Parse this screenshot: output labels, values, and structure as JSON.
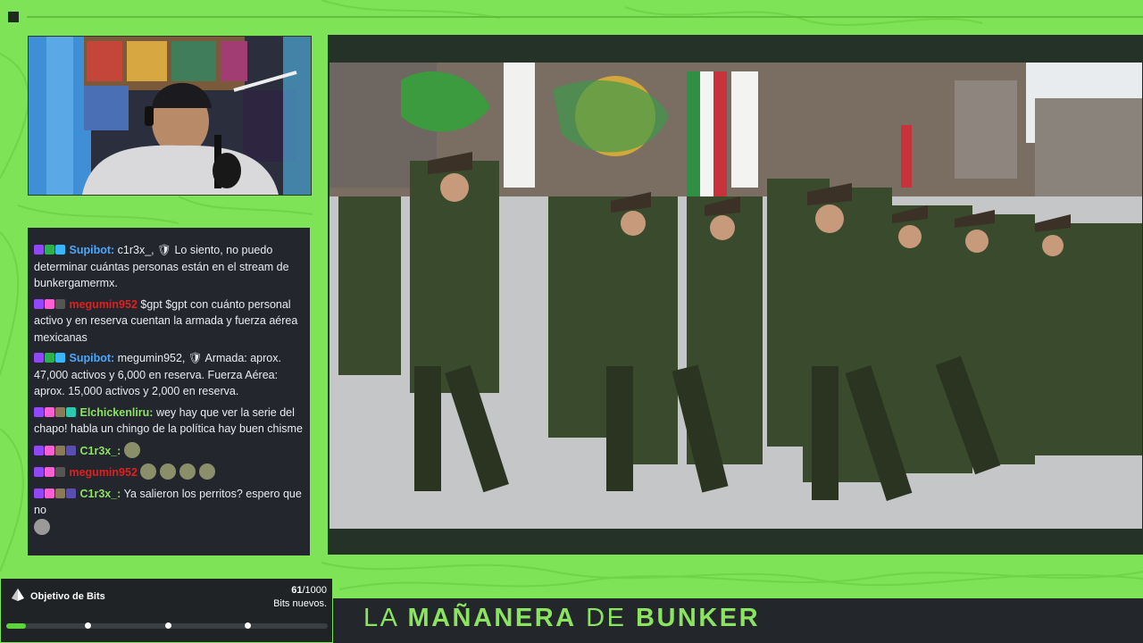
{
  "chat": {
    "messages": [
      {
        "user": "Supibot:",
        "user_color": "#4aa8ff",
        "text": "c1r3x_, 🛡 Lo siento, no puedo determinar cuántas personas están en el stream de bunkergamermx."
      },
      {
        "user": "megumin952",
        "user_color": "#e02020",
        "text": "$gpt $gpt con cuánto personal activo y en reserva cuentan la armada y fuerza aérea mexicanas"
      },
      {
        "user": "Supibot:",
        "user_color": "#4aa8ff",
        "text": "megumin952, 🛡 Armada: aprox. 47,000 activos y 6,000 en reserva. Fuerza Aérea: aprox. 15,000 activos y 2,000 en reserva."
      },
      {
        "user": "Elchickenliru:",
        "user_color": "#8be45f",
        "text": "wey hay que ver la serie del chapo! habla un chingo de la política hay buen chisme"
      },
      {
        "user": "C1r3x_:",
        "user_color": "#8be45f",
        "text": ""
      },
      {
        "user": "megumin952",
        "user_color": "#e02020",
        "text": ""
      },
      {
        "user": "C1r3x_:",
        "user_color": "#8be45f",
        "text": "Ya salieron los perritos? espero que no"
      }
    ]
  },
  "bits_widget": {
    "title": "Objetivo de Bits",
    "current": "61",
    "goal": "/1000",
    "subtitle": "Bits nuevos.",
    "progress": 0.061
  },
  "banner": {
    "word1": "LA",
    "word2": "MAÑANERA",
    "word3": "DE",
    "word4": "BUNKER"
  },
  "colors": {
    "background": "#7ee356",
    "accent": "#8be45f",
    "chat_bg": "#23262d"
  },
  "icons": {
    "corner": "square-icon",
    "bits_logo": "triangle-bits-icon"
  }
}
